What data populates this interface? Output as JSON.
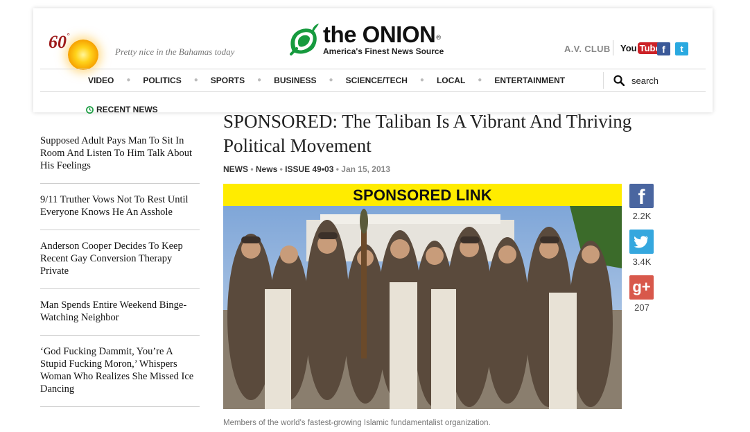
{
  "weather": {
    "temperature": "60",
    "degree": "°",
    "description": "Pretty nice in the Bahamas today"
  },
  "logo": {
    "wordmark": "the ONION",
    "registered": "®",
    "tagline": "America's Finest News Source"
  },
  "header_links": {
    "avclub": "A.V. CLUB",
    "youtube_you": "You",
    "youtube_tube": "Tube",
    "facebook": "f",
    "twitter": "t"
  },
  "nav": {
    "items": [
      "VIDEO",
      "POLITICS",
      "SPORTS",
      "BUSINESS",
      "SCIENCE/TECH",
      "LOCAL",
      "ENTERTAINMENT"
    ],
    "search_placeholder": "search"
  },
  "sidebar": {
    "heading": "RECENT NEWS",
    "items": [
      "Supposed Adult Pays Man To Sit In Room And Listen To Him Talk About His Feelings",
      "9/11 Truther Vows Not To Rest Until Everyone Knows He An Asshole",
      "Anderson Cooper Decides To Keep Recent Gay Conversion Therapy Private",
      "Man Spends Entire Weekend Binge-Watching Neighbor",
      "‘God Fucking Dammit, You’re A Stupid Fucking Moron,’ Whispers Woman Who Realizes She Missed Ice Dancing"
    ]
  },
  "article": {
    "headline": "SPONSORED: The Taliban Is A Vibrant And Thriving Political Movement",
    "section": "NEWS",
    "subsection": "News",
    "issue": "ISSUE 49•03",
    "date": "Jan 15, 2013",
    "banner": "SPONSORED LINK",
    "caption": "Members of the world's fastest-growing Islamic fundamentalist organization."
  },
  "share": {
    "facebook_count": "2.2K",
    "twitter_count": "3.4K",
    "googleplus_count": "207",
    "colors": {
      "facebook": "#4a66a0",
      "twitter": "#35a7de",
      "googleplus": "#d8584b"
    }
  },
  "icons": [
    "onion-logo-icon",
    "sun-icon",
    "search-icon",
    "clock-icon",
    "facebook-icon",
    "twitter-icon",
    "google-plus-icon",
    "youtube-icon"
  ]
}
